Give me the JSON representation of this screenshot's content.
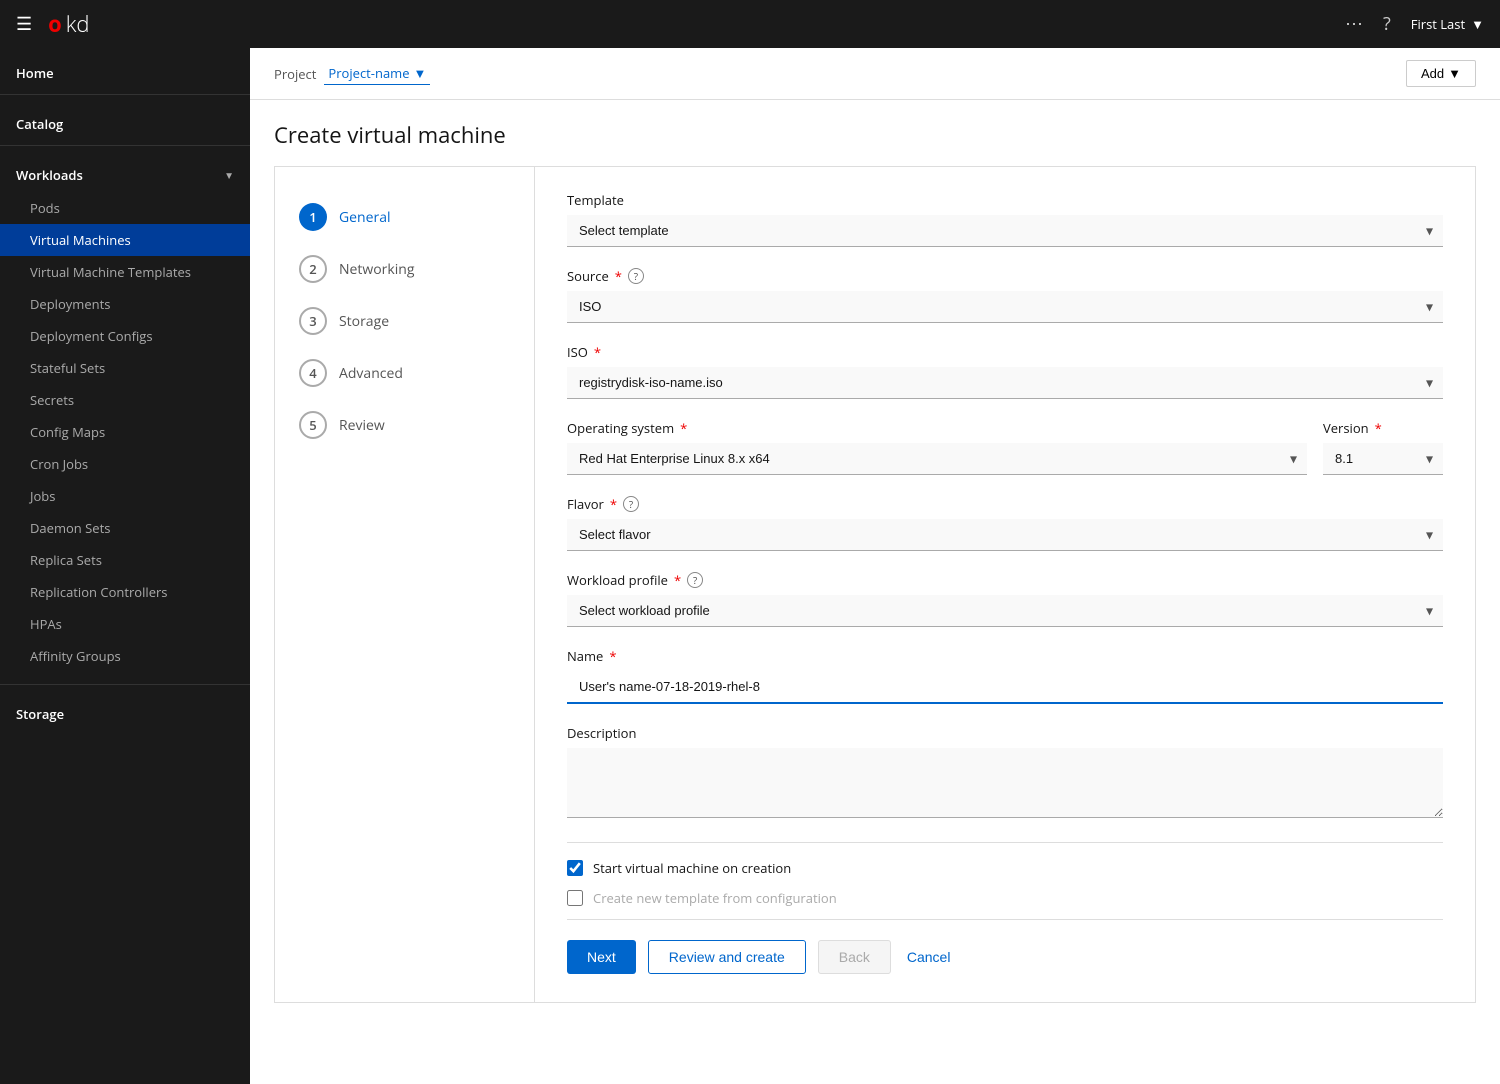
{
  "topnav": {
    "logo_o": "o",
    "logo_kd": "kd",
    "user_label": "First Last"
  },
  "header": {
    "project_label": "Project",
    "project_name": "Project-name",
    "add_label": "Add"
  },
  "page": {
    "title": "Create virtual machine"
  },
  "sidebar": {
    "home_label": "Home",
    "catalog_label": "Catalog",
    "workloads_label": "Workloads",
    "items": [
      {
        "label": "Pods",
        "key": "pods"
      },
      {
        "label": "Virtual Machines",
        "key": "virtual-machines",
        "active": true
      },
      {
        "label": "Virtual Machine Templates",
        "key": "vm-templates"
      },
      {
        "label": "Deployments",
        "key": "deployments"
      },
      {
        "label": "Deployment Configs",
        "key": "deployment-configs"
      },
      {
        "label": "Stateful Sets",
        "key": "stateful-sets"
      },
      {
        "label": "Secrets",
        "key": "secrets"
      },
      {
        "label": "Config Maps",
        "key": "config-maps"
      },
      {
        "label": "Cron Jobs",
        "key": "cron-jobs"
      },
      {
        "label": "Jobs",
        "key": "jobs"
      },
      {
        "label": "Daemon Sets",
        "key": "daemon-sets"
      },
      {
        "label": "Replica Sets",
        "key": "replica-sets"
      },
      {
        "label": "Replication Controllers",
        "key": "replication-controllers"
      },
      {
        "label": "HPAs",
        "key": "hpas"
      },
      {
        "label": "Affinity Groups",
        "key": "affinity-groups"
      }
    ],
    "storage_label": "Storage"
  },
  "wizard": {
    "steps": [
      {
        "number": "1",
        "label": "General",
        "active": true
      },
      {
        "number": "2",
        "label": "Networking",
        "active": false
      },
      {
        "number": "3",
        "label": "Storage",
        "active": false
      },
      {
        "number": "4",
        "label": "Advanced",
        "active": false
      },
      {
        "number": "5",
        "label": "Review",
        "active": false
      }
    ],
    "form": {
      "template_label": "Template",
      "template_placeholder": "Select template",
      "source_label": "Source",
      "source_value": "ISO",
      "iso_label": "ISO",
      "iso_value": "registrydisk-iso-name.iso",
      "os_label": "Operating system",
      "os_value": "Red Hat Enterprise Linux 8.x x64",
      "version_label": "Version",
      "version_value": "8.1",
      "flavor_label": "Flavor",
      "flavor_placeholder": "Select flavor",
      "workload_label": "Workload profile",
      "workload_placeholder": "Select workload profile",
      "name_label": "Name",
      "name_value": "User's name-07-18-2019-rhel-8",
      "description_label": "Description",
      "checkbox1_label": "Start virtual machine on creation",
      "checkbox2_label": "Create new template from configuration",
      "btn_next": "Next",
      "btn_review": "Review and create",
      "btn_back": "Back",
      "btn_cancel": "Cancel"
    }
  }
}
